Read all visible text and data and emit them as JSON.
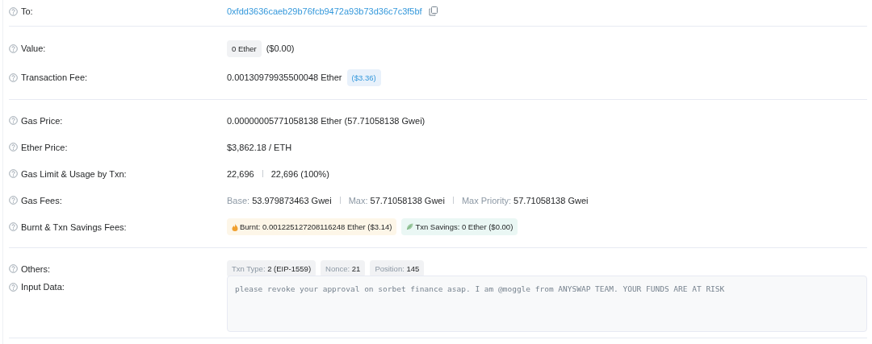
{
  "sections": [
    {
      "rows": [
        {
          "label": "To:",
          "kind": "address",
          "value": "0xfdd3636caeb29b76fcb9472a93b73d36c7c3f5bf"
        }
      ]
    },
    {
      "rows": [
        {
          "label": "Value:",
          "kind": "amount",
          "badge": "0 Ether",
          "value": "($0.00)"
        },
        {
          "label": "Transaction Fee:",
          "kind": "fee",
          "value": "0.00130979935500048 Ether",
          "badge": "($3.36)"
        }
      ]
    },
    {
      "rows": [
        {
          "label": "Gas Price:",
          "kind": "text",
          "value": "0.00000005771058138 Ether (57.71058138 Gwei)"
        },
        {
          "label": "Ether Price:",
          "kind": "text",
          "value": "$3,862.18 / ETH"
        },
        {
          "label": "Gas Limit & Usage by Txn:",
          "kind": "parts",
          "items": [
            {
              "value": "22,696"
            },
            {
              "value": "22,696 (100%)"
            }
          ]
        },
        {
          "label": "Gas Fees:",
          "kind": "parts",
          "items": [
            {
              "name": "Base:",
              "value": "53.979873463 Gwei"
            },
            {
              "name": "Max:",
              "value": "57.71058138 Gwei"
            },
            {
              "name": "Max Priority:",
              "value": "57.71058138 Gwei"
            }
          ]
        },
        {
          "label": "Burnt & Txn Savings Fees:",
          "kind": "savings",
          "burnt": "Burnt: 0.001225127208116248 Ether ($3.14)",
          "savings": "Txn Savings: 0 Ether ($0.00)"
        }
      ]
    },
    {
      "rows": [
        {
          "label": "Others:",
          "kind": "pills",
          "items": [
            {
              "name": "Txn Type:",
              "value": "2 (EIP-1559)"
            },
            {
              "name": "Nonce:",
              "value": "21"
            },
            {
              "name": "Position:",
              "value": "145"
            }
          ]
        },
        {
          "label": "Input Data:",
          "kind": "input",
          "value": "please revoke your approval on sorbet finance asap. I am @moggle from ANYSWAP TEAM. YOUR FUNDS ARE AT RISK"
        }
      ]
    }
  ]
}
